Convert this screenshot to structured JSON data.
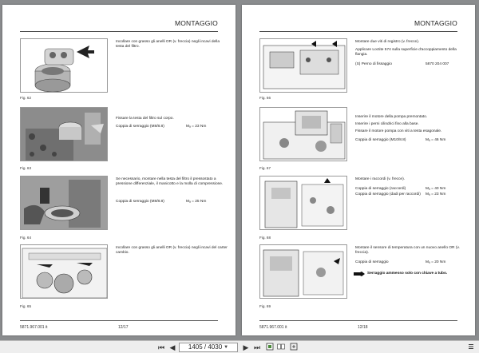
{
  "left_page": {
    "header": "MONTAGGIO",
    "footer_code": "5871.967.001 it",
    "footer_page": "12/17",
    "figures": [
      {
        "label": "Fig. 62",
        "text": "Incollare con grasso gli anelli OR (v. freccia) negli incavi della testa del filtro.",
        "torque_label": "",
        "torque_value": ""
      },
      {
        "label": "Fig. 63",
        "text": "Fissare la testa del filtro sul corpo.",
        "torque_label": "Coppia di serraggio (M8/8.8)",
        "torque_value": "Mₐ = 23 Nm"
      },
      {
        "label": "Fig. 64",
        "text": "Se necessario, montare nella testa del filtro il pressostato a pressione differenziale, il manicotto e la molla di compressione.",
        "torque_label": "Coppia di serraggio (M8/8.8)",
        "torque_value": "Mₐ = 25 Nm"
      },
      {
        "label": "Fig. 65",
        "text": "Incollare con grasso gli anelli OR (v. freccia) negli incavi del carter cambio.",
        "torque_label": "",
        "torque_value": ""
      }
    ]
  },
  "right_page": {
    "header": "MONTAGGIO",
    "footer_code": "5871.967.001 it",
    "footer_page": "12/18",
    "figures": [
      {
        "label": "Fig. 66",
        "lines": [
          "Montare due viti di registro (v. frecce).",
          "Applicare Loctite 574 sulla superficie d'accoppiamento della flangia."
        ],
        "part_label": "(S) Perno di fissaggio",
        "part_number": "5870 204 007"
      },
      {
        "label": "Fig. 67",
        "lines": [
          "Inserire il motore della pompa premontato.",
          "Inserire i perni cilindrici fino alla base.",
          "Fissare il motore pompa con viti a testa esagonale."
        ],
        "torque_label": "Coppia di serraggio (M10/8.8)",
        "torque_value": "Mₐ = 46 Nm"
      },
      {
        "label": "Fig. 68",
        "lines": [
          "Montare i raccordi (v. frecce)."
        ],
        "torque_rows": [
          {
            "label": "Coppia di serraggio (raccordi)",
            "value": "Mₐ = 40 Nm"
          },
          {
            "label": "Coppia di serraggio (dadi per raccordi)",
            "value": "Mₐ = 23 Nm"
          }
        ]
      },
      {
        "label": "Fig. 69",
        "lines": [
          "Montare il sensore di temperatura con un nuovo anello OR (v. freccia)."
        ],
        "torque_label": "Coppia di serraggio",
        "torque_value": "Mₐ = 20 Nm",
        "warning": "Serraggio ammesso solo con chiave a tubo."
      }
    ]
  },
  "toolbar": {
    "page_value": "1405 / 4030"
  }
}
